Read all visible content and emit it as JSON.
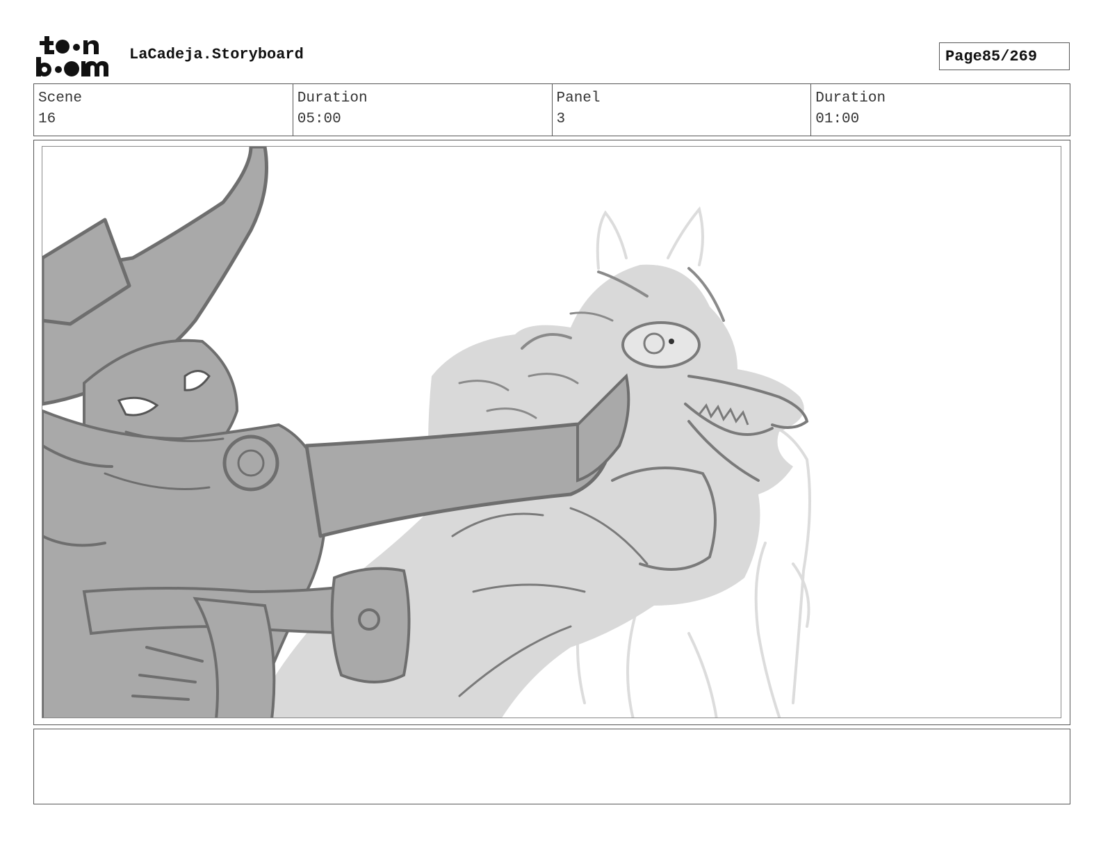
{
  "header": {
    "logo_text": "toon boom",
    "project_title": "LaCadeja.Storyboard",
    "page_label": "Page",
    "page_number": "85/269"
  },
  "info": {
    "scene_label": "Scene",
    "scene_value": "16",
    "scene_duration_label": "Duration",
    "scene_duration_value": "05:00",
    "panel_label": "Panel",
    "panel_value": "3",
    "panel_duration_label": "Duration",
    "panel_duration_value": "01:00"
  },
  "notes": {
    "text": ""
  },
  "colors": {
    "frame": "#555555",
    "sketch_dark": "#6e6e6e",
    "sketch_mid": "#a9a9a9",
    "sketch_light": "#d9d9d9"
  }
}
